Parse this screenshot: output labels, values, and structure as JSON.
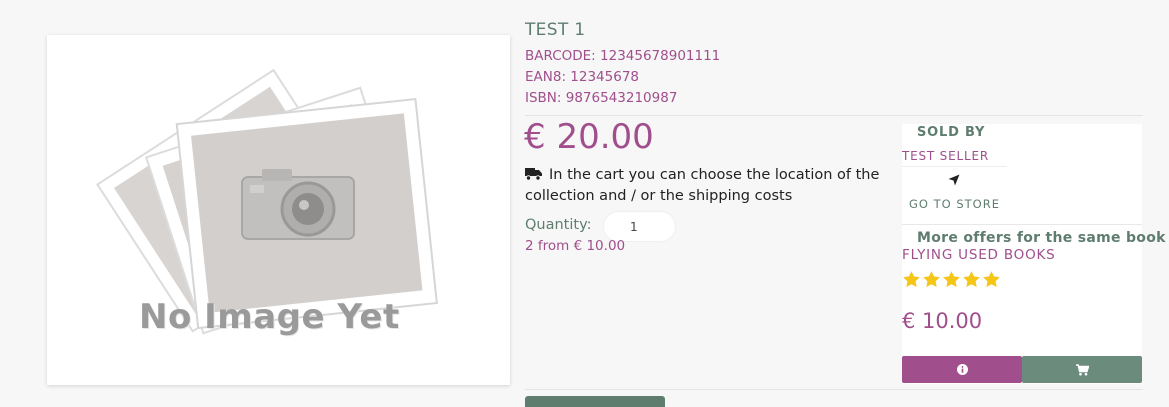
{
  "product": {
    "title": "TEST 1",
    "barcode": "BARCODE: 12345678901111",
    "ean8": "EAN8: 12345678",
    "isbn": "ISBN: 9876543210987",
    "price": "€ 20.00",
    "shipping_note": "In the cart you can choose the location of the collection and / or the shipping costs",
    "quantity_label": "Quantity:",
    "quantity_value": "1",
    "offers_summary": "2 from € 10.00",
    "image_placeholder_text": "No Image Yet"
  },
  "seller": {
    "sold_by_label": "SOLD BY",
    "name": "TEST SELLER",
    "go_to_store_label": "GO TO STORE"
  },
  "more_offers": {
    "heading": "More offers for the same book",
    "seller": "FLYING USED BOOKS",
    "rating": 5,
    "rating_max": 5,
    "price": "€ 10.00"
  },
  "icons": {
    "truck": "truck-icon",
    "navigation": "location-arrow-icon",
    "info": "info-circle-icon",
    "cart": "shopping-cart-icon",
    "star": "star-icon"
  },
  "colors": {
    "accent_purple": "#a04f8c",
    "accent_green": "#5f7d6f",
    "star_yellow": "#f5c518"
  }
}
